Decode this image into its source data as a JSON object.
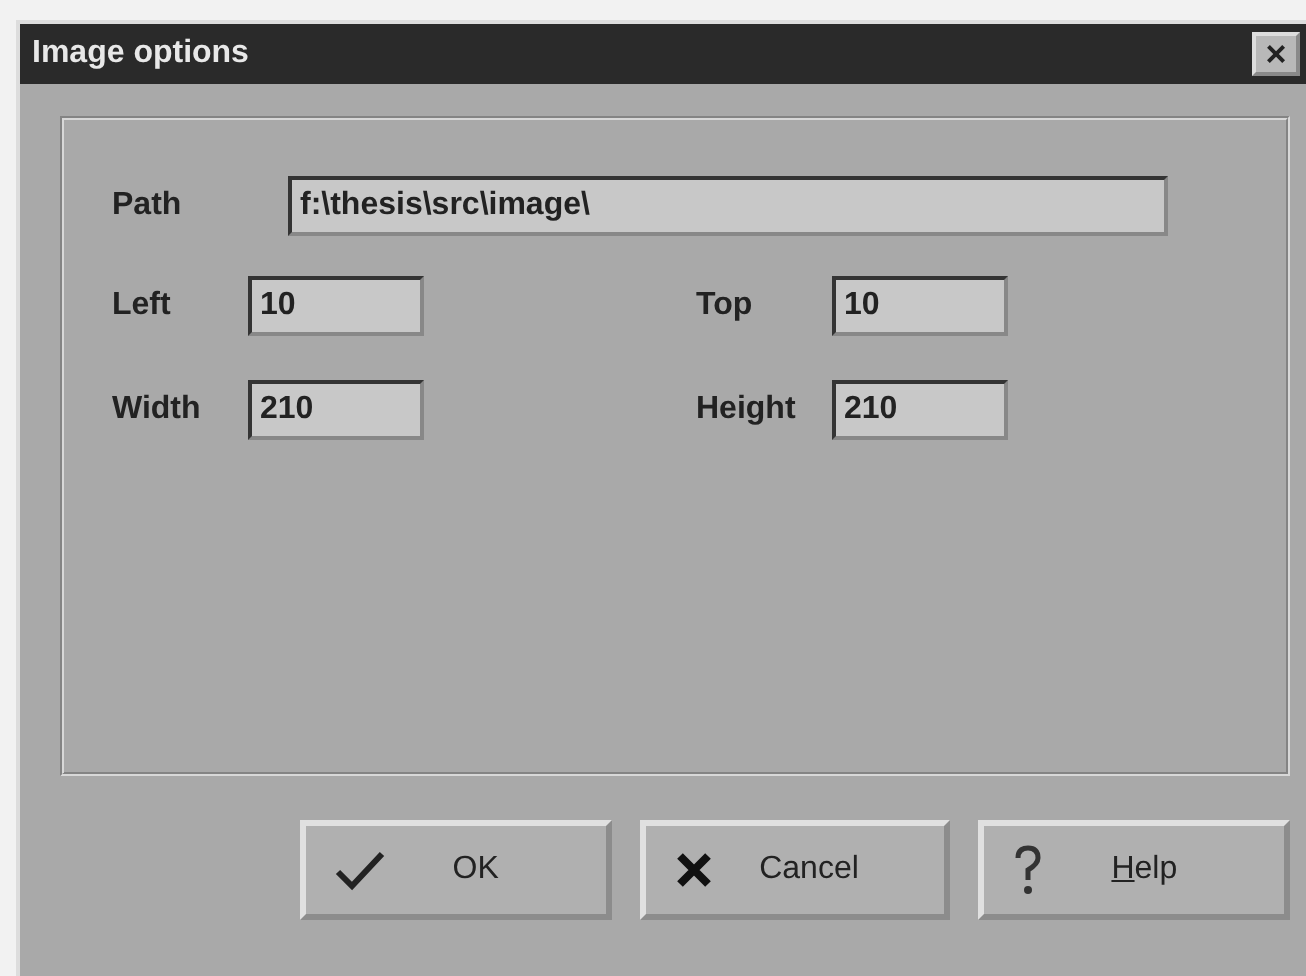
{
  "window": {
    "title": "Image options",
    "close_button": "×"
  },
  "path": {
    "label": "Path",
    "value": "f:\\thesis\\src\\image\\"
  },
  "fields": [
    {
      "label": "Left",
      "value": "10"
    },
    {
      "label": "Top",
      "value": "10"
    },
    {
      "label": "Width",
      "value": "210"
    },
    {
      "label": "Height",
      "value": "210"
    }
  ],
  "buttons": [
    {
      "kind": "confirm",
      "label": "OK",
      "underlined_first": false
    },
    {
      "kind": "cancel",
      "label": "Cancel",
      "underlined_first": false
    },
    {
      "kind": "help",
      "label": "Help",
      "underlined_first": true
    }
  ]
}
